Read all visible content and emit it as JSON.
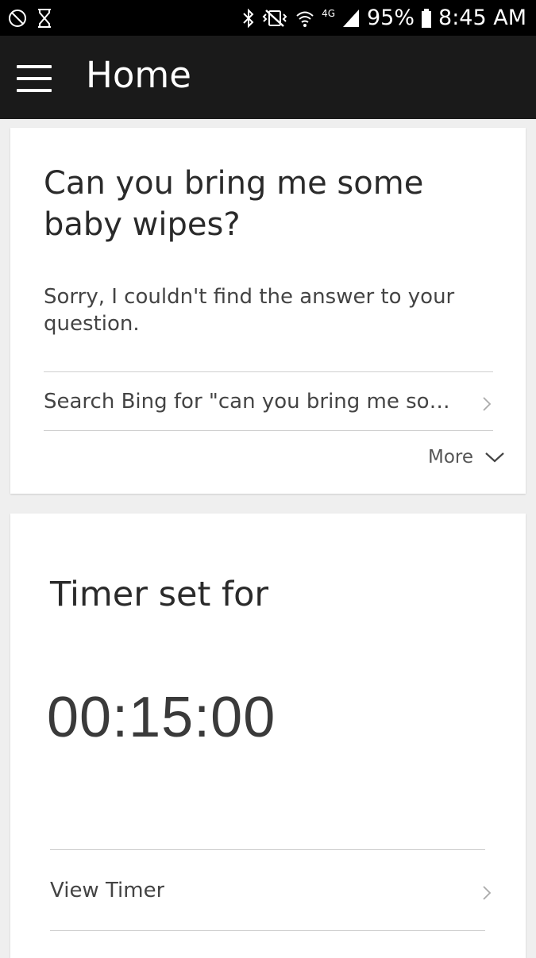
{
  "status_bar": {
    "icons_left": [
      "do-not-disturb-icon",
      "hourglass-icon"
    ],
    "icons_right": [
      "bluetooth-icon",
      "vibrate-mute-icon",
      "wifi-icon",
      "lte-icon",
      "signal-icon"
    ],
    "network_label": "4G",
    "battery": "95%",
    "time": "8:45 AM"
  },
  "app_bar": {
    "title": "Home"
  },
  "answer_card": {
    "question": "Can you bring me some baby wipes?",
    "answer": "Sorry, I couldn't find the answer to your question.",
    "search_link": "Search Bing for \"can you bring me som…",
    "more_label": "More"
  },
  "timer_card": {
    "label": "Timer set for",
    "value": "00:15:00",
    "view_link": "View Timer"
  }
}
